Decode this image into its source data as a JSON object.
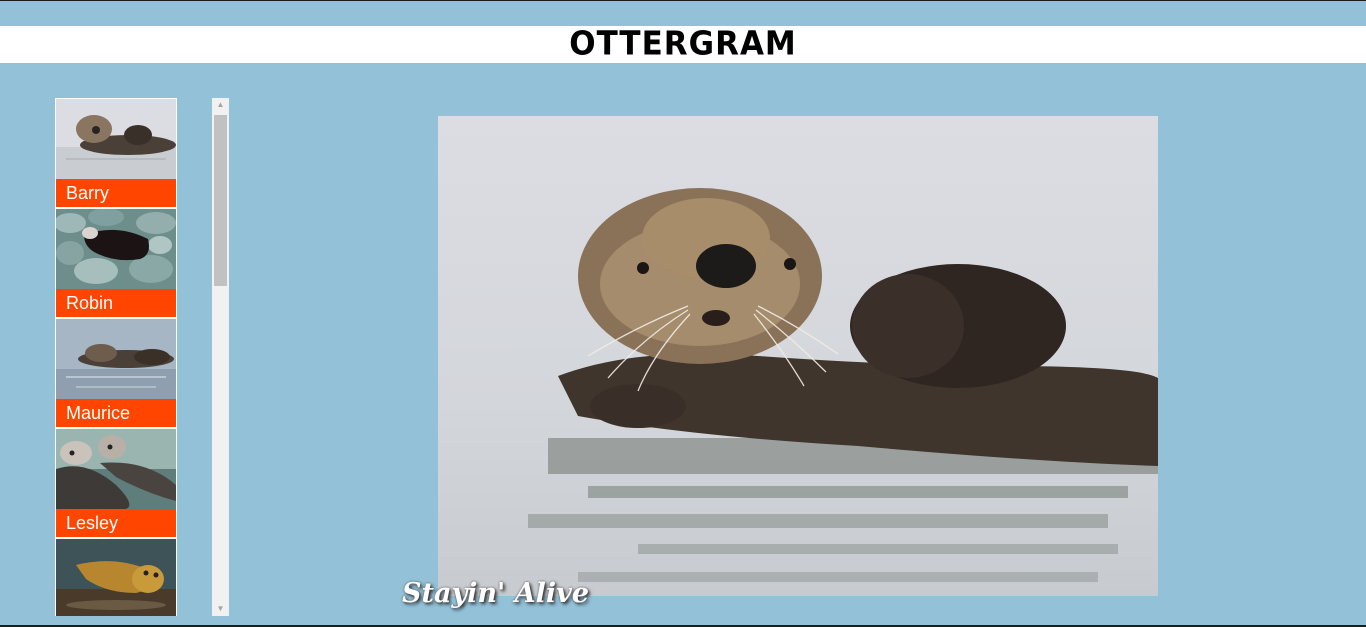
{
  "header": {
    "logo": "OTTERGRAM"
  },
  "thumbnails": [
    {
      "name": "Barry"
    },
    {
      "name": "Robin"
    },
    {
      "name": "Maurice"
    },
    {
      "name": "Lesley"
    },
    {
      "name": ""
    }
  ],
  "detail": {
    "title": "Stayin' Alive"
  },
  "colors": {
    "page_bg": "#92c1d8",
    "header_bg": "#ffffff",
    "label_bg": "#ff4500",
    "label_text": "#ffffff"
  }
}
